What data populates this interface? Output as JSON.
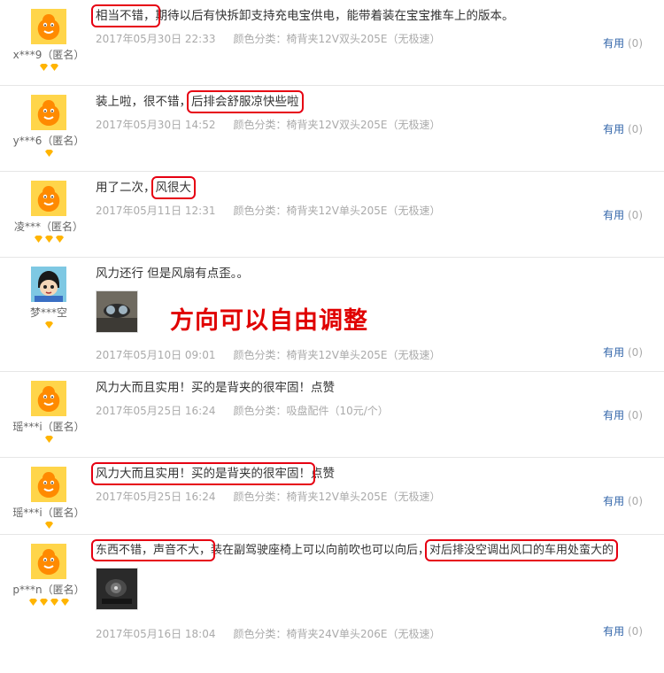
{
  "reviews": [
    {
      "user": "x***9（匿名）",
      "diamonds": 2,
      "text_parts": [
        {
          "t": "相当不错，",
          "hl": true
        },
        {
          "t": "期待以后有快拆卸支持充电宝供电，能带着装在宝宝推车上的版本。",
          "hl": false
        }
      ],
      "date": "2017年05月30日 22:33",
      "sku": "颜色分类：椅背夹12V双头205E（无极速）",
      "useful_label": "有用",
      "useful_count": "(0)"
    },
    {
      "user": "y***6（匿名）",
      "diamonds": 1,
      "text_parts": [
        {
          "t": "装上啦，很不错，",
          "hl": false
        },
        {
          "t": "后排会舒服凉快些啦",
          "hl": true
        }
      ],
      "date": "2017年05月30日 14:52",
      "sku": "颜色分类：椅背夹12V双头205E（无极速）",
      "useful_label": "有用",
      "useful_count": "(0)"
    },
    {
      "user": "凌***（匿名）",
      "diamonds": 3,
      "text_parts": [
        {
          "t": "用了二次，",
          "hl": false
        },
        {
          "t": "风很大",
          "hl": true
        }
      ],
      "date": "2017年05月11日 12:31",
      "sku": "颜色分类：椅背夹12V单头205E（无极速）",
      "useful_label": "有用",
      "useful_count": "(0)"
    },
    {
      "user": "梦***空",
      "diamonds": 1,
      "text_parts": [
        {
          "t": "风力还行 但是风扇有点歪。。",
          "hl": false
        }
      ],
      "note": "方向可以自由调整",
      "date": "2017年05月10日 09:01",
      "sku": "颜色分类：椅背夹12V单头205E（无极速）",
      "useful_label": "有用",
      "useful_count": "(0)"
    },
    {
      "user": "瑶***i（匿名）",
      "diamonds": 1,
      "text_parts": [
        {
          "t": "风力大而且实用！买的是背夹的很牢固！点赞",
          "hl": false
        }
      ],
      "date": "2017年05月25日 16:24",
      "sku": "颜色分类：吸盘配件（10元/个）",
      "useful_label": "有用",
      "useful_count": "(0)"
    },
    {
      "user": "瑶***i（匿名）",
      "diamonds": 1,
      "text_parts": [
        {
          "t": "风力大而且实用！买的是背夹的很牢固！",
          "hl": true
        },
        {
          "t": "点赞",
          "hl": false
        }
      ],
      "date": "2017年05月25日 16:24",
      "sku": "颜色分类：椅背夹12V单头205E（无极速）",
      "useful_label": "有用",
      "useful_count": "(0)"
    },
    {
      "user": "p***n（匿名）",
      "diamonds": 4,
      "text_parts": [
        {
          "t": "东西不错，声音不大，",
          "hl": true
        },
        {
          "t": "装在副驾驶座椅上可以向前吹也可以向后，",
          "hl": false
        },
        {
          "t": "对后排没空调出风口的车用处蛮大的",
          "hl": true
        }
      ],
      "date": "2017年05月16日 18:04",
      "sku": "颜色分类：椅背夹24V单头206E（无极速）",
      "useful_label": "有用",
      "useful_count": "(0)"
    }
  ],
  "colors": {
    "accent_red": "#e60012",
    "useful_blue": "#3366aa",
    "meta_gray": "#aaaaaa",
    "avatar_orange": "#ff8a00"
  }
}
